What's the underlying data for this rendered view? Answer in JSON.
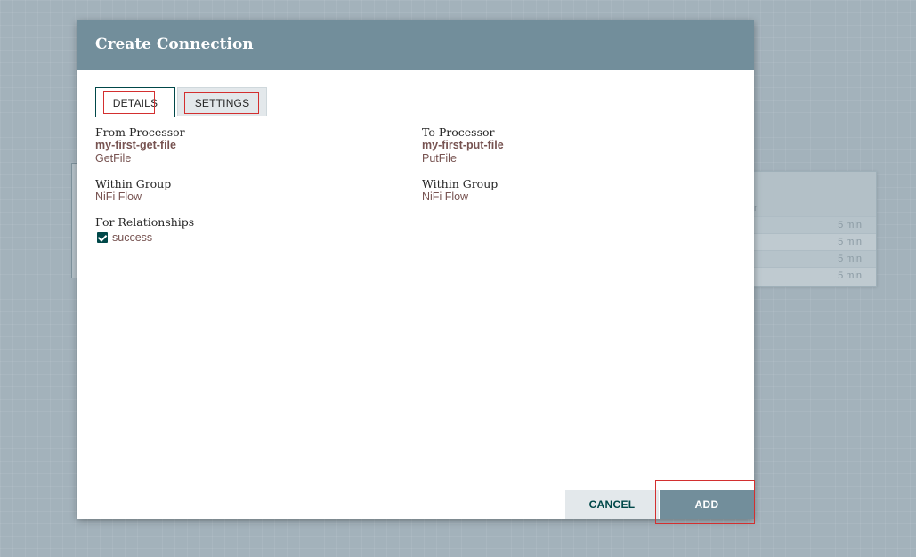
{
  "dialog": {
    "title": "Create Connection",
    "tabs": [
      {
        "label": "DETAILS",
        "active": true
      },
      {
        "label": "SETTINGS",
        "active": false
      }
    ]
  },
  "details": {
    "from": {
      "label": "From Processor",
      "name": "my-first-get-file",
      "type": "GetFile",
      "group_label": "Within Group",
      "group": "NiFi Flow"
    },
    "to": {
      "label": "To Processor",
      "name": "my-first-put-file",
      "type": "PutFile",
      "group_label": "Within Group",
      "group": "NiFi Flow"
    },
    "relationships": {
      "label": "For Relationships",
      "items": [
        {
          "name": "success",
          "checked": true
        }
      ]
    }
  },
  "buttons": {
    "cancel": "CANCEL",
    "add": "ADD"
  },
  "background": {
    "header_fragment": "r",
    "rows": [
      "5 min",
      "5 min",
      "5 min",
      "5 min"
    ]
  },
  "colors": {
    "header": "#728e9b",
    "accent": "#004849",
    "value_text": "#775351",
    "highlight": "#d32f2f"
  }
}
